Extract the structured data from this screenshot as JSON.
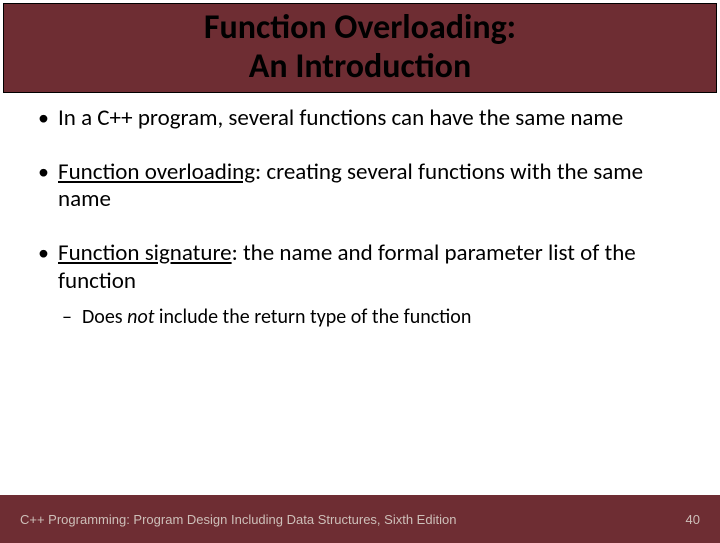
{
  "title": {
    "line1": "Function Overloading:",
    "line2": "An Introduction"
  },
  "bullets": {
    "b1": {
      "text": "In a C++ program, several functions can have the same name"
    },
    "b2": {
      "term": "Function overloading",
      "rest": ": creating several functions with the same name"
    },
    "b3": {
      "term": "Function signature",
      "rest": ": the name and formal parameter list of the function",
      "sub": {
        "pre": "Does ",
        "em": "not",
        "post": " include the return type of the function"
      }
    }
  },
  "footer": {
    "text": "C++ Programming: Program Design Including Data Structures, Sixth Edition",
    "page": "40"
  }
}
